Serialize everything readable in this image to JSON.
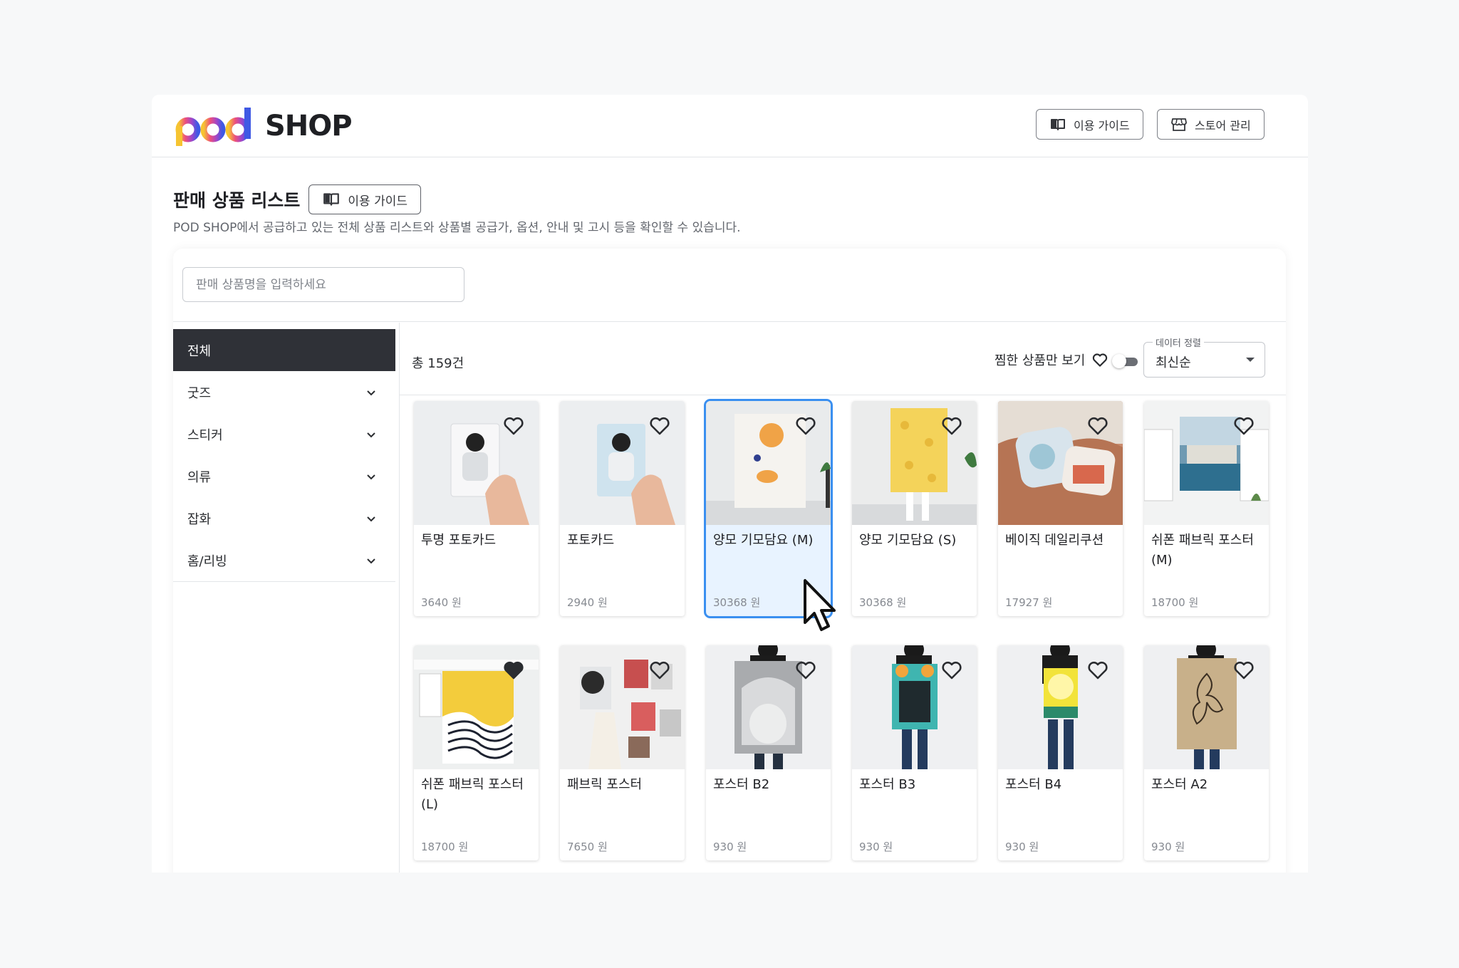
{
  "header": {
    "logo_pod": "pod",
    "logo_shop": "SHOP",
    "guide_label": "이용 가이드",
    "store_label": "스토어 관리"
  },
  "page": {
    "title": "판매 상품 리스트",
    "guide_label": "이용 가이드",
    "description": "POD SHOP에서 공급하고 있는 전체 상품 리스트와 상품별 공급가, 옵션, 안내 및 고시 등을 확인할 수 있습니다."
  },
  "search": {
    "placeholder": "판매 상품명을 입력하세요"
  },
  "categories": [
    {
      "label": "전체",
      "active": true
    },
    {
      "label": "굿즈"
    },
    {
      "label": "스티커"
    },
    {
      "label": "의류"
    },
    {
      "label": "잡화"
    },
    {
      "label": "홈/리빙"
    }
  ],
  "list": {
    "total": "총 159건",
    "fav_only_label": "찜한 상품만 보기",
    "sort_label": "데이터 정렬",
    "sort_value": "최신순"
  },
  "products": [
    {
      "name": "투명 포토카드",
      "price": "3640 원",
      "liked": false
    },
    {
      "name": "포토카드",
      "price": "2940 원",
      "liked": false
    },
    {
      "name": "양모 기모담요 (M)",
      "price": "30368 원",
      "liked": false,
      "selected": true
    },
    {
      "name": "양모 기모담요 (S)",
      "price": "30368 원",
      "liked": false
    },
    {
      "name": "베이직 데일리쿠션",
      "price": "17927 원",
      "liked": false
    },
    {
      "name": "쉬폰 패브릭 포스터 (M)",
      "price": "18700 원",
      "liked": false
    },
    {
      "name": "쉬폰 패브릭 포스터 (L)",
      "price": "18700 원",
      "liked": true
    },
    {
      "name": "패브릭 포스터",
      "price": "7650 원",
      "liked": false
    },
    {
      "name": "포스터 B2",
      "price": "930 원",
      "liked": false
    },
    {
      "name": "포스터 B3",
      "price": "930 원",
      "liked": false
    },
    {
      "name": "포스터 B4",
      "price": "930 원",
      "liked": false
    },
    {
      "name": "포스터 A2",
      "price": "930 원",
      "liked": false
    }
  ],
  "colors": {
    "accent": "#3a8ff0",
    "sidebar_active": "#2f3137"
  }
}
